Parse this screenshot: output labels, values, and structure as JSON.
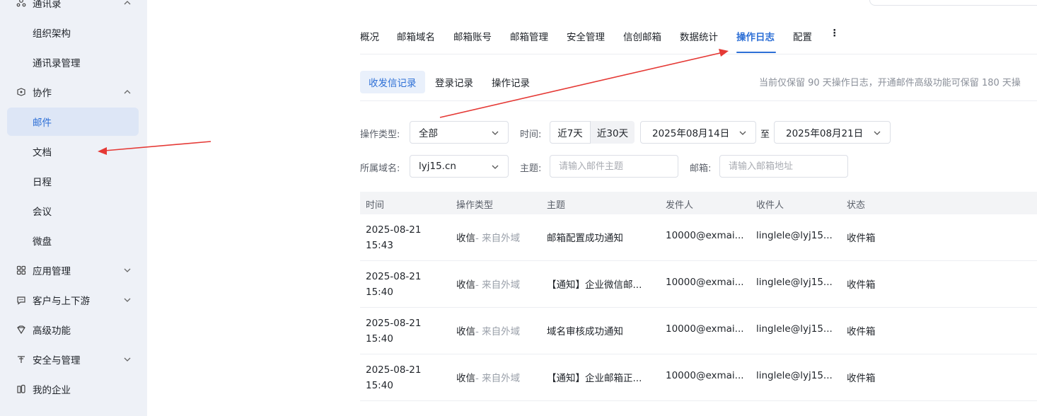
{
  "sidebar": {
    "items": [
      {
        "label": "通讯录",
        "icon": "contacts-icon",
        "type": "group",
        "chevron": "up"
      },
      {
        "label": "组织架构",
        "type": "child"
      },
      {
        "label": "通讯录管理",
        "type": "child"
      },
      {
        "label": "协作",
        "icon": "collab-icon",
        "type": "group",
        "chevron": "up"
      },
      {
        "label": "邮件",
        "type": "child",
        "active": true
      },
      {
        "label": "文档",
        "type": "child"
      },
      {
        "label": "日程",
        "type": "child"
      },
      {
        "label": "会议",
        "type": "child"
      },
      {
        "label": "微盘",
        "type": "child"
      },
      {
        "label": "应用管理",
        "icon": "apps-grid-icon",
        "type": "group",
        "chevron": "down"
      },
      {
        "label": "客户与上下游",
        "icon": "chat-bubble-icon",
        "type": "group",
        "chevron": "down"
      },
      {
        "label": "高级功能",
        "icon": "diamond-icon",
        "type": "group"
      },
      {
        "label": "安全与管理",
        "icon": "security-icon",
        "type": "group",
        "chevron": "down"
      },
      {
        "label": "我的企业",
        "icon": "building-icon",
        "type": "group"
      }
    ]
  },
  "tabs": {
    "items": [
      "概况",
      "邮箱域名",
      "邮箱账号",
      "邮箱管理",
      "安全管理",
      "信创邮箱",
      "数据统计",
      "操作日志",
      "配置"
    ],
    "active": "操作日志",
    "more_icon": "more-vertical-icon"
  },
  "subtabs": {
    "items": [
      "收发信记录",
      "登录记录",
      "操作记录"
    ],
    "active": "收发信记录",
    "hint": "当前仅保留 90 天操作日志，开通邮件高级功能可保留 180 天操"
  },
  "filters": {
    "op_type_label": "操作类型:",
    "op_type_value": "全部",
    "time_label": "时间:",
    "range_7": "近7天",
    "range_30": "近30天",
    "start_date": "2025年08月14日",
    "to_label": "至",
    "end_date": "2025年08月21日",
    "domain_label": "所属域名:",
    "domain_value": "lyj15.cn",
    "subject_label": "主题:",
    "subject_placeholder": "请输入邮件主题",
    "mailbox_label": "邮箱:",
    "mailbox_placeholder": "请输入邮箱地址"
  },
  "table": {
    "columns": [
      "时间",
      "操作类型",
      "主题",
      "发件人",
      "收件人",
      "状态"
    ],
    "rows": [
      {
        "date": "2025-08-21",
        "time": "15:43",
        "type": "收信",
        "type_note": "- 来自外域",
        "subject": "邮箱配置成功通知",
        "from": "10000@exmai...",
        "to": "linglele@lyj15...",
        "status": "收件箱"
      },
      {
        "date": "2025-08-21",
        "time": "15:40",
        "type": "收信",
        "type_note": "- 来自外域",
        "subject": "【通知】企业微信邮...",
        "from": "10000@exmai...",
        "to": "linglele@lyj15...",
        "status": "收件箱"
      },
      {
        "date": "2025-08-21",
        "time": "15:40",
        "type": "收信",
        "type_note": "- 来自外域",
        "subject": "域名审核成功通知",
        "from": "10000@exmai...",
        "to": "linglele@lyj15...",
        "status": "收件箱"
      },
      {
        "date": "2025-08-21",
        "time": "15:40",
        "type": "收信",
        "type_note": "- 来自外域",
        "subject": "【通知】企业邮箱正...",
        "from": "10000@exmai...",
        "to": "linglele@lyj15...",
        "status": "收件箱"
      }
    ]
  },
  "colors": {
    "accent": "#2d6fd6",
    "annotation_arrow": "#e53935",
    "sidebar_bg": "#eef1f7"
  }
}
